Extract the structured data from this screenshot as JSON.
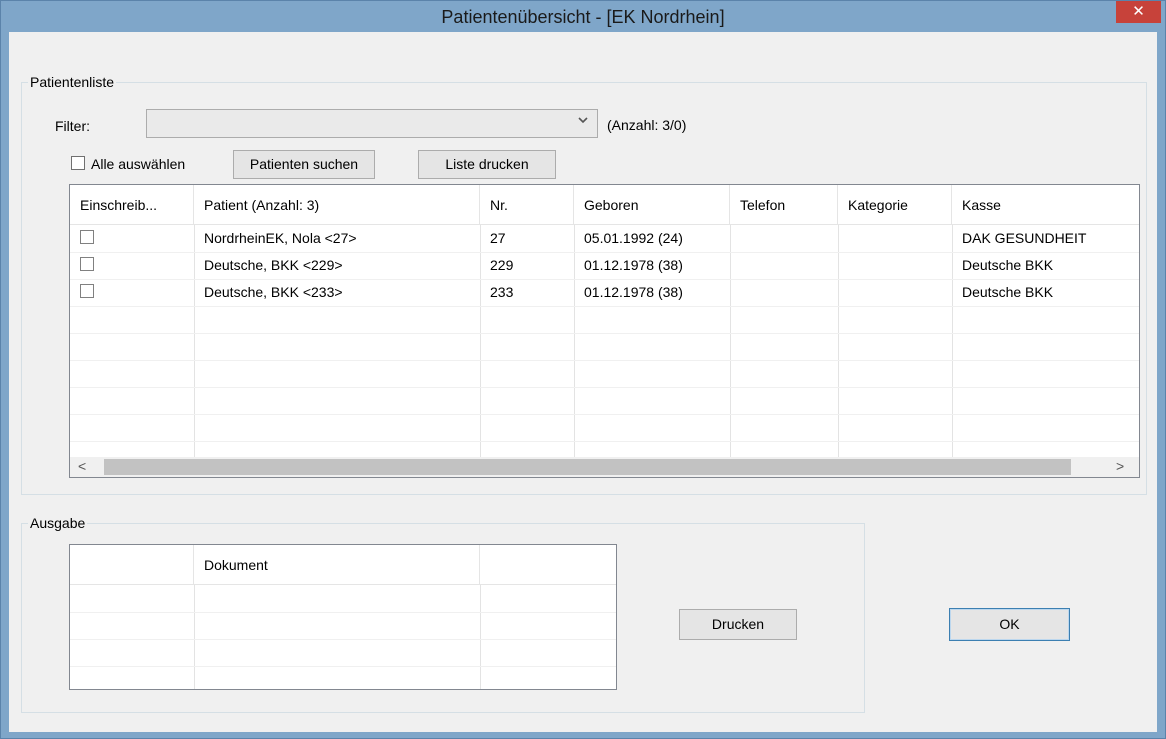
{
  "window": {
    "title": "Patientenübersicht - [EK Nordrhein]",
    "close_glyph": "✕"
  },
  "patientenliste": {
    "legend": "Patientenliste",
    "filter_label": "Filter:",
    "filter_value": "",
    "count_label": "(Anzahl: 3/0)",
    "select_all_label": "Alle auswählen",
    "search_button": "Patienten suchen",
    "print_list_button": "Liste drucken",
    "columns": [
      "Einschreib...",
      "Patient (Anzahl: 3)",
      "Nr.",
      "Geboren",
      "Telefon",
      "Kategorie",
      "Kasse"
    ],
    "rows": [
      [
        "",
        "NordrheinEK,  Nola <27>",
        "27",
        "05.01.1992 (24)",
        "",
        "",
        "DAK GESUNDHEIT"
      ],
      [
        "",
        "Deutsche,  BKK <229>",
        "229",
        "01.12.1978 (38)",
        "",
        "",
        "Deutsche BKK"
      ],
      [
        "",
        "Deutsche,  BKK <233>",
        "233",
        "01.12.1978 (38)",
        "",
        "",
        "Deutsche BKK"
      ]
    ],
    "scroll_left": "<",
    "scroll_right": ">"
  },
  "ausgabe": {
    "legend": "Ausgabe",
    "columns": [
      "",
      "Dokument",
      ""
    ],
    "print_button": "Drucken"
  },
  "ok_button": "OK",
  "icons": {
    "dropdown": "chevron-down-icon",
    "close": "close-icon"
  }
}
